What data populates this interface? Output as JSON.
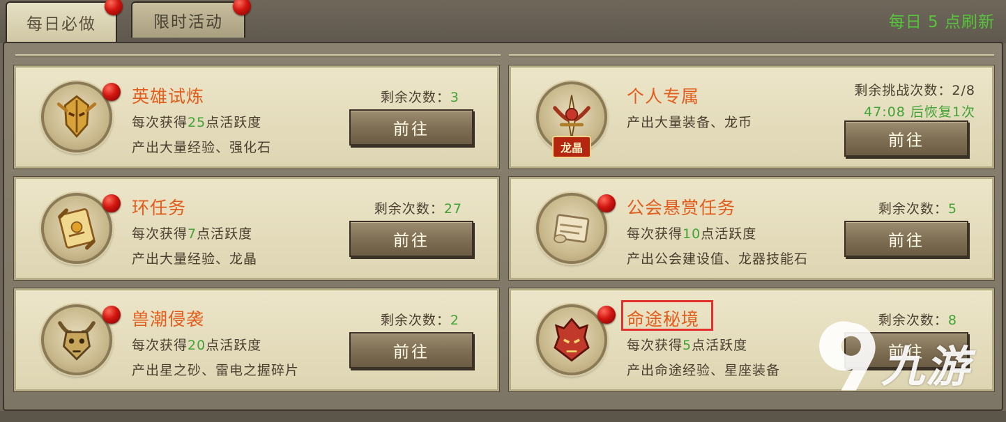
{
  "tabs": [
    {
      "label": "每日必做",
      "active": true,
      "has_dot": true
    },
    {
      "label": "限时活动",
      "active": false,
      "has_dot": true
    }
  ],
  "refresh_text": "每日 5 点刷新",
  "button_label": "前往",
  "colors": {
    "title": "#e25d1c",
    "highlight_number": "#3fa334",
    "refresh": "#56c43c",
    "red_dot": "#d0150f",
    "annotation_box": "#e2302a"
  },
  "cards": [
    {
      "title": "英雄试炼",
      "icon": "golden-helmet-icon",
      "line1_pre": "每次获得",
      "line1_num": "25",
      "line1_post": "点活跃度",
      "line2": "产出大量经验、强化石",
      "remain_label": "剩余次数：",
      "remain_value": "3"
    },
    {
      "title": "个人专属",
      "icon": "dragon-crest-icon",
      "badge": "龙晶",
      "line1": "产出大量装备、龙币",
      "remain_label": "剩余挑战次数：",
      "remain_value": "2/8",
      "recovery": "47:08 后恢复1次"
    },
    {
      "title": "环任务",
      "icon": "scroll-quest-icon",
      "line1_pre": "每次获得",
      "line1_num": "7",
      "line1_post": "点活跃度",
      "line2": "产出大量经验、龙晶",
      "remain_label": "剩余次数：",
      "remain_value": "27"
    },
    {
      "title": "公会悬赏任务",
      "icon": "guild-scroll-icon",
      "line1_pre": "每次获得",
      "line1_num": "10",
      "line1_post": "点活跃度",
      "line2": "产出公会建设值、龙器技能石",
      "remain_label": "剩余次数：",
      "remain_value": "5"
    },
    {
      "title": "兽潮侵袭",
      "icon": "beast-mask-icon",
      "line1_pre": "每次获得",
      "line1_num": "20",
      "line1_post": "点活跃度",
      "line2": "产出星之砂、雷电之握碎片",
      "remain_label": "剩余次数：",
      "remain_value": "2"
    },
    {
      "title": "命途秘境",
      "icon": "demon-mask-icon",
      "line1_pre": "每次获得",
      "line1_num": "5",
      "line1_post": "点活跃度",
      "line2": "产出命途经验、星座装备",
      "remain_label": "剩余次数：",
      "remain_value": "8",
      "highlighted": true
    }
  ],
  "watermark": {
    "text": "九游"
  }
}
